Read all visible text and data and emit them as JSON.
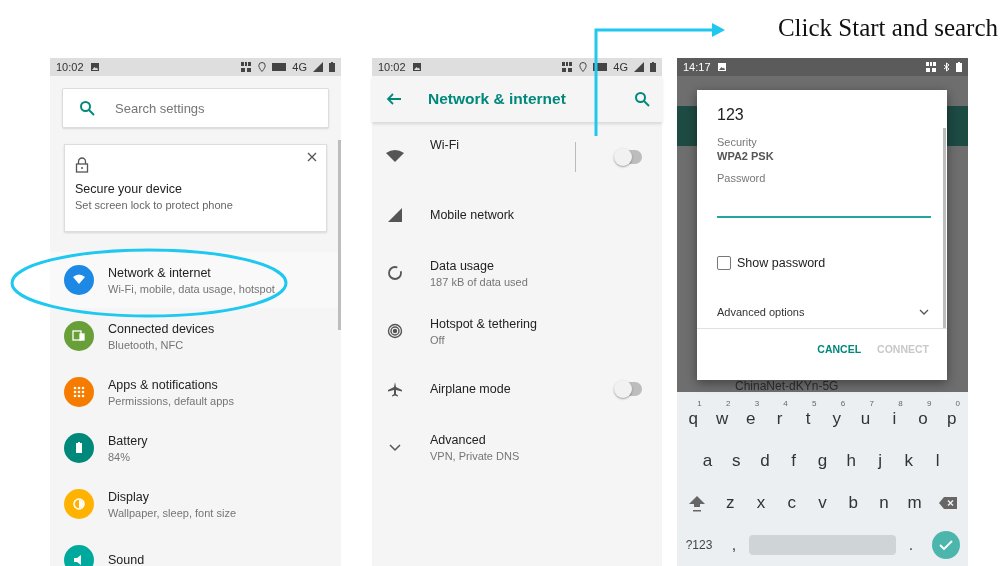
{
  "annotation": {
    "text": "Click Start and search"
  },
  "settings_screen": {
    "status": {
      "time": "10:02",
      "network": "4G"
    },
    "search": {
      "placeholder": "Search settings"
    },
    "card": {
      "title": "Secure your device",
      "subtitle": "Set screen lock to protect phone"
    },
    "items": [
      {
        "title": "Network & internet",
        "subtitle": "Wi-Fi, mobile, data usage, hotspot",
        "color": "#1e88e5",
        "circled": true
      },
      {
        "title": "Connected devices",
        "subtitle": "Bluetooth, NFC",
        "color": "#689f38",
        "circled": false
      },
      {
        "title": "Apps & notifications",
        "subtitle": "Permissions, default apps",
        "color": "#f57c00",
        "circled": false
      },
      {
        "title": "Battery",
        "subtitle": "84%",
        "color": "#00897b",
        "circled": false
      },
      {
        "title": "Display",
        "subtitle": "Wallpaper, sleep, font size",
        "color": "#ffb300",
        "circled": false
      },
      {
        "title": "Sound",
        "color": "#00a99d",
        "circled": false
      }
    ]
  },
  "network_screen": {
    "status": {
      "time": "10:02",
      "network": "4G"
    },
    "title": "Network & internet",
    "items": [
      {
        "kind": "toggle",
        "title": "Wi-Fi",
        "on": false
      },
      {
        "kind": "plain",
        "title": "Mobile network"
      },
      {
        "kind": "plain",
        "title": "Data usage",
        "subtitle": "187 kB of data used"
      },
      {
        "kind": "plain",
        "title": "Hotspot & tethering",
        "subtitle": "Off"
      },
      {
        "kind": "toggle",
        "title": "Airplane mode",
        "on": false
      },
      {
        "kind": "expand",
        "title": "Advanced",
        "subtitle": "VPN, Private DNS"
      }
    ]
  },
  "wifi_screen": {
    "status": {
      "time": "14:17"
    },
    "background_network": "ChinaNet-dKYn-5G",
    "dialog": {
      "title": "123",
      "security_label": "Security",
      "security_value": "WPA2 PSK",
      "password_label": "Password",
      "show_password": {
        "label": "Show password",
        "checked": false
      },
      "advanced": "Advanced options",
      "buttons": [
        {
          "label": "CANCEL",
          "disabled": false
        },
        {
          "label": "CONNECT",
          "disabled": true
        }
      ]
    },
    "keyboard": {
      "rows": [
        [
          {
            "label": "q",
            "hint": "1"
          },
          {
            "label": "w",
            "hint": "2"
          },
          {
            "label": "e",
            "hint": "3"
          },
          {
            "label": "r",
            "hint": "4"
          },
          {
            "label": "t",
            "hint": "5"
          },
          {
            "label": "y",
            "hint": "6"
          },
          {
            "label": "u",
            "hint": "7"
          },
          {
            "label": "i",
            "hint": "8"
          },
          {
            "label": "o",
            "hint": "9"
          },
          {
            "label": "p",
            "hint": "0"
          }
        ],
        [
          {
            "label": "a"
          },
          {
            "label": "s"
          },
          {
            "label": "d"
          },
          {
            "label": "f"
          },
          {
            "label": "g"
          },
          {
            "label": "h"
          },
          {
            "label": "j"
          },
          {
            "label": "k"
          },
          {
            "label": "l"
          }
        ],
        [
          {
            "label": "z"
          },
          {
            "label": "x"
          },
          {
            "label": "c"
          },
          {
            "label": "v"
          },
          {
            "label": "b"
          },
          {
            "label": "n"
          },
          {
            "label": "m"
          }
        ]
      ],
      "symbols": "?123",
      "comma": ",",
      "period": "."
    }
  }
}
